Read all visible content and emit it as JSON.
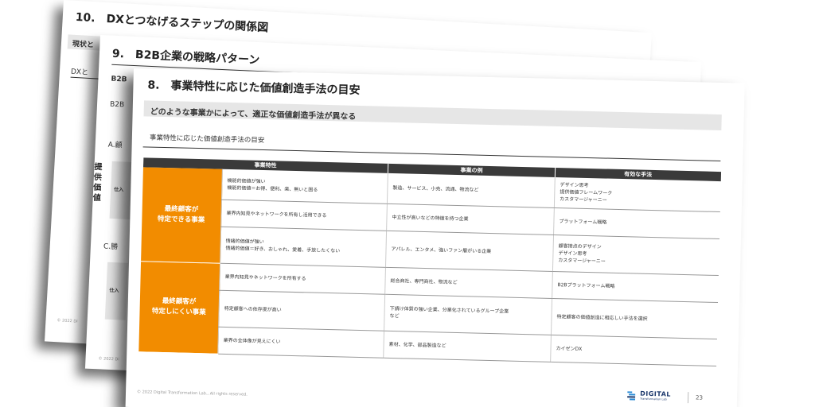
{
  "back_slide": {
    "title": "10.　DXとつなげるステップの関係図",
    "bar_text": "現状と",
    "sub_text": "DXと",
    "copyright": "© 2022 Di"
  },
  "middle_slide": {
    "title": "9.　B2B企業の戦略パターン",
    "label_1": "B2B",
    "label_2": "B2B",
    "label_3": "A.顧",
    "label_4": "C.勝",
    "vertical_label": "提供価値",
    "box_label_1": "仕入",
    "box_label_2": "仕入",
    "copyright": "© 2022 Di"
  },
  "front_slide": {
    "title": "8.　事業特性に応じた価値創造手法の目安",
    "subtitle": "どのような事業かによって、適正な価値創造手法が異なる",
    "section_title": "事業特性に応じた価値創造手法の目安",
    "table": {
      "headers": [
        "事業特性",
        "事業の例",
        "有効な手法"
      ],
      "groups": [
        {
          "label": "最終顧客が\n特定できる事業",
          "rows": [
            {
              "trait": [
                "機能的価値が強い",
                "機能的価値＝お得、便利、楽、無いと困る"
              ],
              "example": [
                "製造、サービス、小売、流通、物流など"
              ],
              "method": [
                "デザイン思考",
                "提供価値フレームワーク",
                "カスタマージャーニー"
              ]
            },
            {
              "trait": [
                "業界内知見やネットワークを所有し活用できる"
              ],
              "example": [
                "中立性が高いなどの特徴を持つ企業"
              ],
              "method": [
                "プラットフォーム戦略"
              ]
            },
            {
              "trait": [
                "情緒的価値が強い",
                "情緒的価値＝好き、おしゃれ、愛着、手放したくない"
              ],
              "example": [
                "アパレル、エンタメ、強いファン層がいる企業"
              ],
              "method": [
                "顧客接点のデザイン",
                "デザイン思考",
                "カスタマージャーニー"
              ]
            }
          ]
        },
        {
          "label": "最終顧客が\n特定しにくい事業",
          "rows": [
            {
              "trait": [
                "業界内知見やネットワークを所有する"
              ],
              "example": [
                "総合商社、専門商社、物流など"
              ],
              "method": [
                "B2Bプラットフォーム戦略"
              ]
            },
            {
              "trait": [
                "特定顧客への依存度が高い"
              ],
              "example": [
                "下請け体質の強い企業、分業化されているグループ企業",
                "など"
              ],
              "method": [
                "特定顧客の価値創造に相応しい手法を選択"
              ]
            },
            {
              "trait": [
                "業界の全体像が見えにくい"
              ],
              "example": [
                "素材、化学、部品製造など"
              ],
              "method": [
                "カイゼンDX"
              ]
            }
          ]
        }
      ]
    },
    "copyright": "© 2022 Digital Transformation Lab., All rights reserved.",
    "logo_text": "DIGITAL",
    "logo_subtext": "Transformation Lab",
    "page_number": "23"
  },
  "colors": {
    "accent_orange": "#f28c00",
    "header_dark": "#3a3a3a",
    "bar_grey": "#e6e6e6"
  }
}
